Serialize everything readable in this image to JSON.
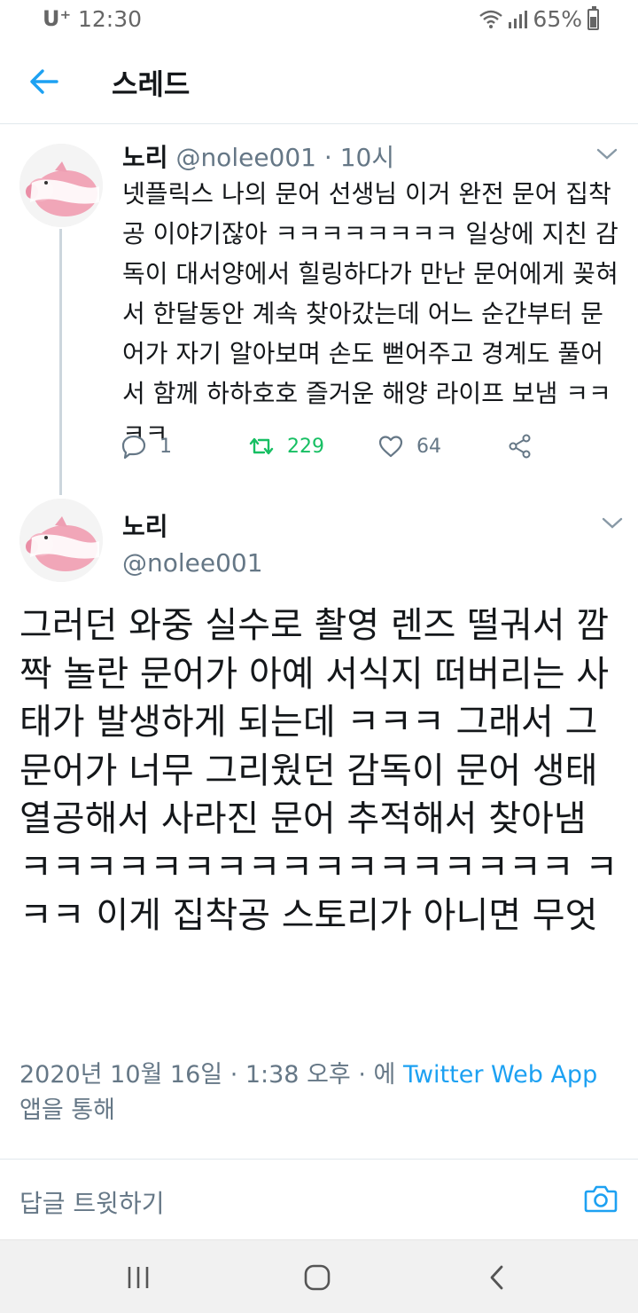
{
  "status_bar": {
    "carrier": "U⁺",
    "time": "12:30",
    "battery": "65%"
  },
  "header": {
    "back_icon": "back-arrow-icon",
    "title": "스레드"
  },
  "tweet1": {
    "name": "노리",
    "handle": "@nolee001",
    "separator": "·",
    "time": "10시",
    "body": "넷플릭스 나의 문어 선생님 이거 완전 문어 집착공 이야기잖아 ㅋㅋㅋㅋㅋㅋㅋㅋ 일상에 지친 감독이 대서양에서 힐링하다가 만난 문어에게 꽂혀서 한달동안 계속 찾아갔는데 어느 순간부터 문어가 자기 알아보며 손도 뻗어주고 경계도 풀어서 함께 하하호호 즐거운 해양 라이프 보냄 ㅋㅋㅋㅋ",
    "actions": {
      "replies": "1",
      "retweets": "229",
      "likes": "64"
    }
  },
  "tweet2": {
    "name": "노리",
    "handle": "@nolee001",
    "body": "그러던 와중 실수로 촬영 렌즈 떨궈서 깜짝 놀란 문어가 아예 서식지 떠버리는 사태가 발생하게 되는데 ㅋㅋㅋ 그래서 그 문어가 너무 그리웠던 감독이 문어 생태 열공해서 사라진 문어 추적해서 찾아냄 ㅋㅋㅋㅋㅋㅋㅋㅋㅋㅋㅋㅋㅋㅋㅋㅋㅋ ㅋㅋㅋ 이게 집착공 스토리가 아니면 무엇",
    "meta_date": "2020년 10월 16일 · 1:38 오후 · 에 ",
    "meta_app": "Twitter Web App",
    "meta_suffix": "앱을 통해"
  },
  "reply_bar": {
    "placeholder": "답글 트윗하기"
  },
  "colors": {
    "accent": "#1da1f2",
    "retweet": "#17bf63",
    "muted": "#657786"
  }
}
